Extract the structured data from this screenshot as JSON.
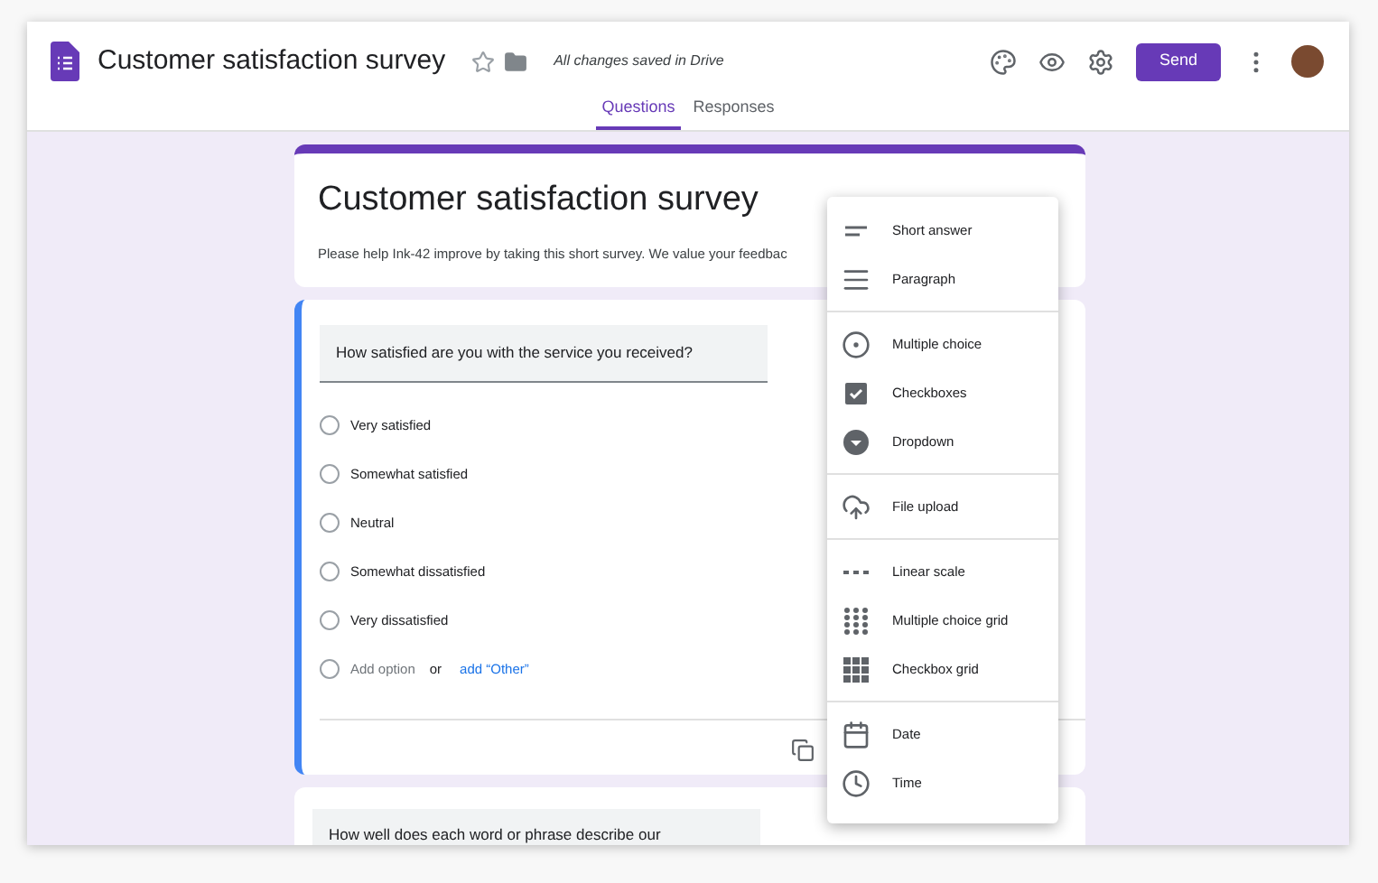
{
  "header": {
    "title": "Customer satisfaction survey",
    "save_status": "All changes saved in Drive",
    "send_button": "Send"
  },
  "tabs": [
    {
      "label": "Questions",
      "selected": true
    },
    {
      "label": "Responses",
      "selected": false
    }
  ],
  "form_header": {
    "title": "Customer satisfaction survey",
    "description": "Please help Ink-42 improve by taking this short survey. We value your feedbac"
  },
  "question": {
    "text": "How satisfied are you with the service you received?",
    "options": [
      "Very satisfied",
      "Somewhat satisfied",
      "Neutral",
      "Somewhat dissatisfied",
      "Very dissatisfied"
    ],
    "add_option": "Add option",
    "or": "or",
    "add_other": "add “Other”"
  },
  "next_question": {
    "text": "How well does each word or phrase describe our"
  },
  "type_menu": [
    [
      {
        "label": "Short answer",
        "kind": "short"
      },
      {
        "label": "Paragraph",
        "kind": "paragraph"
      }
    ],
    [
      {
        "label": "Multiple choice",
        "kind": "radio"
      },
      {
        "label": "Checkboxes",
        "kind": "checkbox"
      },
      {
        "label": "Dropdown",
        "kind": "dropdown"
      }
    ],
    [
      {
        "label": "File upload",
        "kind": "upload"
      }
    ],
    [
      {
        "label": "Linear scale",
        "kind": "scale"
      },
      {
        "label": "Multiple choice grid",
        "kind": "grid"
      },
      {
        "label": "Checkbox grid",
        "kind": "checkgrid"
      }
    ],
    [
      {
        "label": "Date",
        "kind": "date"
      },
      {
        "label": "Time",
        "kind": "time"
      }
    ]
  ]
}
